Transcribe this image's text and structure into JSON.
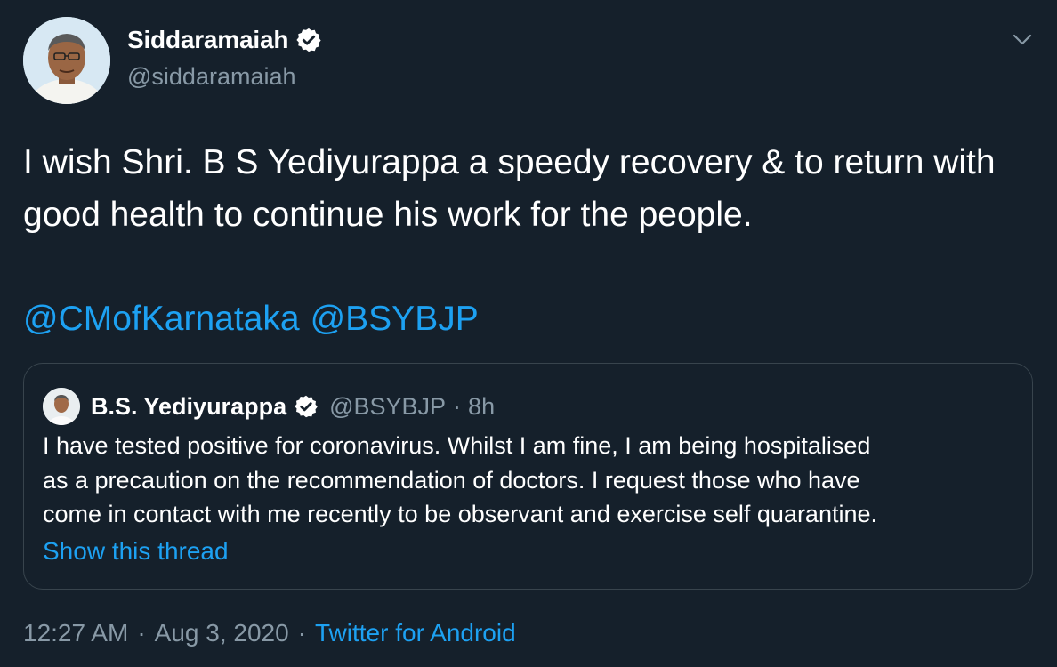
{
  "author": {
    "display_name": "Siddaramaiah",
    "handle": "@siddaramaiah",
    "verified": true
  },
  "icons": {
    "verified": "verified-badge-icon",
    "menu": "chevron-down-icon"
  },
  "tweet": {
    "text": "I wish Shri. B S Yediyurappa a speedy recovery & to return with good health to continue his work for the people.",
    "mentions": [
      "@CMofKarnataka",
      "@BSYBJP"
    ]
  },
  "quote": {
    "display_name": "B.S. Yediyurappa",
    "handle": "@BSYBJP",
    "separator": "·",
    "time": "8h",
    "text_lines": [
      "I have tested positive for coronavirus. Whilst I am fine, I am being hospitalised",
      "as a precaution on the recommendation of doctors. I request those who have",
      "come in contact with me recently to be observant and exercise self quarantine."
    ],
    "show_thread_label": "Show this thread"
  },
  "footer": {
    "time": "12:27 AM",
    "sep1": "·",
    "date": "Aug 3, 2020",
    "sep2": "·",
    "source": "Twitter for Android"
  },
  "colors": {
    "background": "#15202b",
    "text": "#ffffff",
    "secondary_text": "#8899a6",
    "link": "#1da1f2",
    "border": "#38444d"
  }
}
